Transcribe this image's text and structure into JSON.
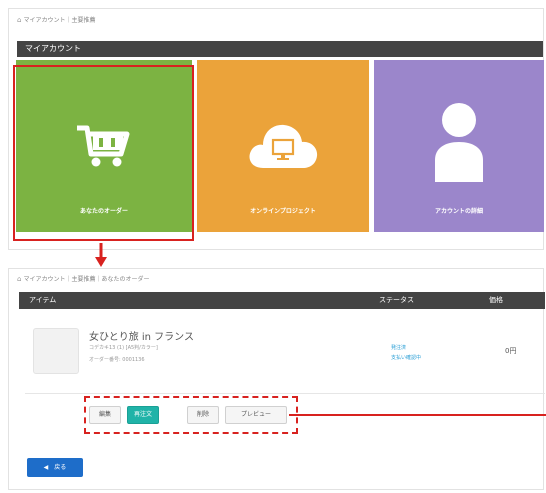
{
  "top": {
    "breadcrumb": "マイアカウント｜主要推薦",
    "section_title": "マイアカウント",
    "tiles": [
      {
        "label": "あなたのオーダー",
        "icon": "shopping-cart-icon",
        "color": "#7cb342"
      },
      {
        "label": "オンラインプロジェクト",
        "icon": "cloud-monitor-icon",
        "color": "#eba33a"
      },
      {
        "label": "アカウントの詳細",
        "icon": "user-icon",
        "color": "#9b86cb"
      }
    ]
  },
  "bottom": {
    "breadcrumb": "マイアカウント｜主要推薦｜あなたのオーダー",
    "columns": {
      "item": "アイテム",
      "status": "ステータス",
      "price": "価格"
    },
    "order": {
      "title": "女ひとり旅 in フランス",
      "sub1": "コデカキ13 (1) [A5判/カラー]",
      "sub2": "オーダー番号: 0001136",
      "status1": "発注済",
      "status2": "支払い確認中",
      "price": "0円"
    },
    "buttons": {
      "edit": "編集",
      "reorder": "再注文",
      "delete": "削除",
      "preview": "プレビュー"
    },
    "back": "戻る"
  },
  "colors": {
    "highlight": "#d8221f",
    "teal": "#20b3a8",
    "primary": "#1e6dc9",
    "header": "#444444"
  }
}
